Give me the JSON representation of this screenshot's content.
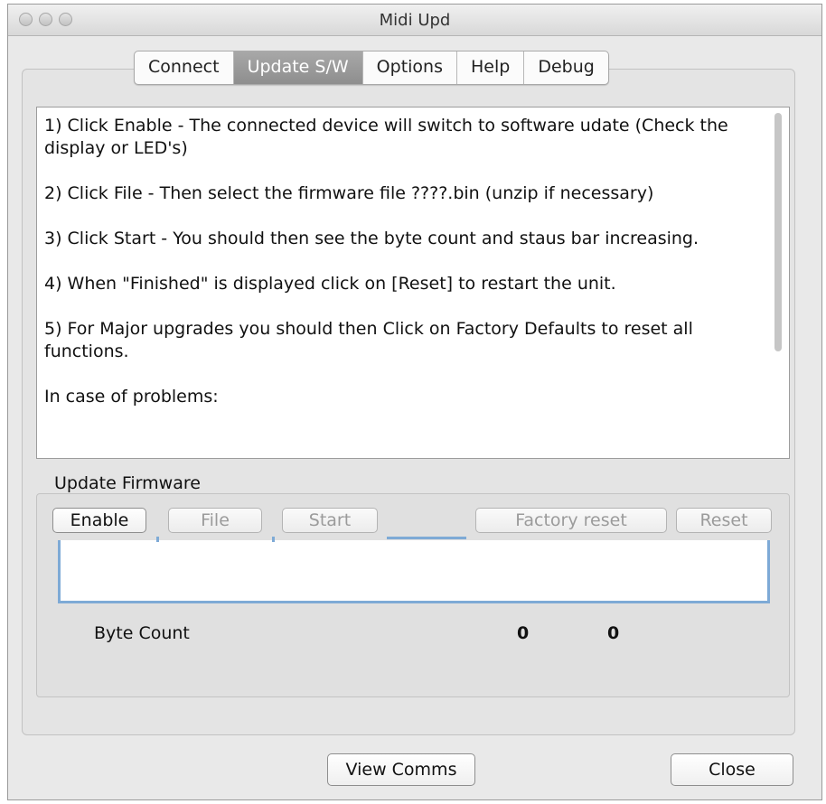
{
  "window": {
    "title": "Midi Upd"
  },
  "tabs": [
    {
      "label": "Connect",
      "active": false
    },
    {
      "label": "Update S/W",
      "active": true
    },
    {
      "label": "Options",
      "active": false
    },
    {
      "label": "Help",
      "active": false
    },
    {
      "label": "Debug",
      "active": false
    }
  ],
  "instructions": {
    "text": "1) Click Enable - The connected device will switch to software udate (Check the display or LED's)\n\n2) Click File - Then select the firmware file ????.bin (unzip if necessary)\n\n3) Click Start - You should then see the byte count and staus bar increasing.\n\n4) When \"Finished\" is displayed click on [Reset] to restart the unit.\n\n5) For Major upgrades you should then Click on Factory Defaults to reset all functions.\n\nIn case of problems:"
  },
  "firmware": {
    "group_label": "Update Firmware",
    "buttons": {
      "enable": "Enable",
      "file": "File",
      "start": "Start",
      "factory_reset": "Factory reset",
      "reset": "Reset"
    },
    "progress": 0,
    "byte_count_label": "Byte Count",
    "byte_count_value_1": "0",
    "byte_count_value_2": "0"
  },
  "footer": {
    "view_comms": "View Comms",
    "close": "Close"
  }
}
